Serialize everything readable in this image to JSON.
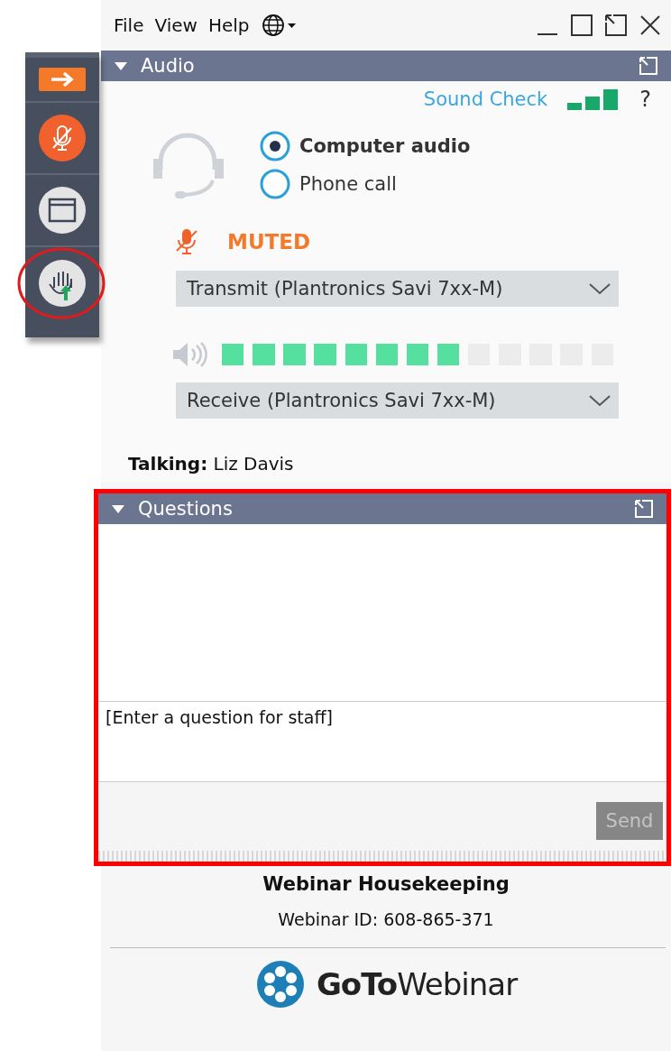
{
  "menu": [
    "File",
    "View",
    "Help"
  ],
  "audio": {
    "title": "Audio",
    "expanded": true,
    "sound_check": "Sound Check",
    "help": "?",
    "modes": [
      {
        "label": "Computer audio",
        "selected": true
      },
      {
        "label": "Phone call",
        "selected": false
      }
    ],
    "mute_status": "MUTED",
    "transmit": "Transmit (Plantronics Savi 7xx-M)",
    "speaker": {
      "level": 0.615
    },
    "receive": "Receive (Plantronics Savi 7xx-M)",
    "talking": "**Talking:** Liz Davis"
  },
  "questions": {
    "title": "Questions",
    "expanded": true,
    "placeholder": "[Enter a question for staff]",
    "send": "Send",
    "send_disabled": true
  },
  "footer": {
    "title": "Webinar Housekeeping",
    "webinar_id": "Webinar ID: 608-865-371",
    "logo": "**GoTo**Webinar"
  }
}
